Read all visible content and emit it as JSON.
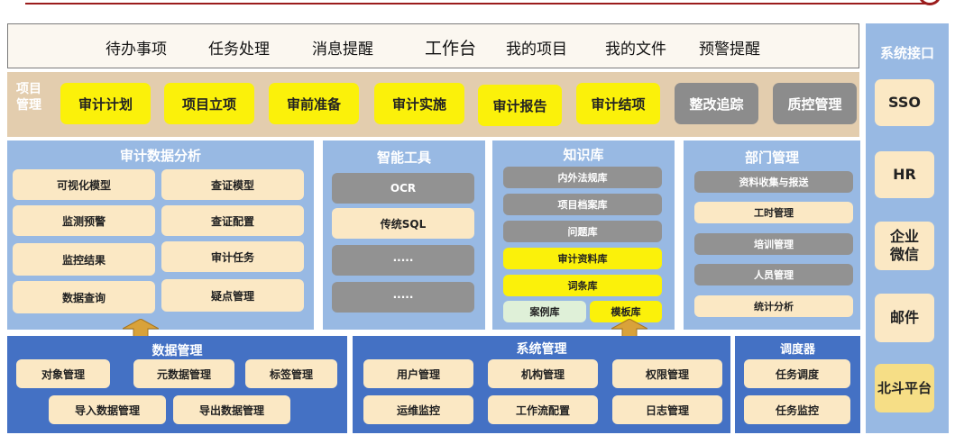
{
  "nav": {
    "items": [
      "待办事项",
      "任务处理",
      "消息提醒",
      "工作台",
      "我的项目",
      "我的文件",
      "预警提醒"
    ]
  },
  "projects": {
    "label": "项目\n管理",
    "items": [
      "审计计划",
      "项目立项",
      "审前准备",
      "审计实施",
      "审计报告",
      "审计结项",
      "整改追踪",
      "质控管理"
    ]
  },
  "audit_analysis": {
    "title": "审计数据分析",
    "cells": [
      "可视化模型",
      "查证模型",
      "监测预警",
      "查证配置",
      "监控结果",
      "审计任务",
      "数据查询",
      "疑点管理"
    ]
  },
  "smart_tools": {
    "title": "智能工具",
    "cells": [
      "OCR",
      "传统SQL",
      "·····",
      "·····"
    ]
  },
  "knowledge": {
    "title": "知识库",
    "cells": [
      "内外法规库",
      "项目档案库",
      "问题库",
      "审计资料库",
      "词条库",
      "案例库",
      "模板库"
    ]
  },
  "dept": {
    "title": "部门管理",
    "cells": [
      "资料收集与报送",
      "工时管理",
      "培训管理",
      "人员管理",
      "统计分析"
    ]
  },
  "data_mgmt": {
    "title": "数据管理",
    "cells": [
      "对象管理",
      "元数据管理",
      "标签管理",
      "导入数据管理",
      "导出数据管理"
    ]
  },
  "sys_mgmt": {
    "title": "系统管理",
    "cells": [
      "用户管理",
      "机构管理",
      "权限管理",
      "运维监控",
      "工作流配置",
      "日志管理"
    ]
  },
  "scheduler": {
    "title": "调度器",
    "cells": [
      "任务调度",
      "任务监控"
    ]
  },
  "interfaces": {
    "title": "系统接口",
    "items": [
      "SSO",
      "HR",
      "企业\n微信",
      "邮件",
      "北斗平台"
    ]
  },
  "colors": {
    "accent_red": "#9b1c1c",
    "panel_blue": "#98b9e3",
    "dark_blue": "#4471c4",
    "highlight_yellow": "#fbf10a",
    "cream": "#fbe8c4",
    "gray": "#8c8c8c"
  }
}
